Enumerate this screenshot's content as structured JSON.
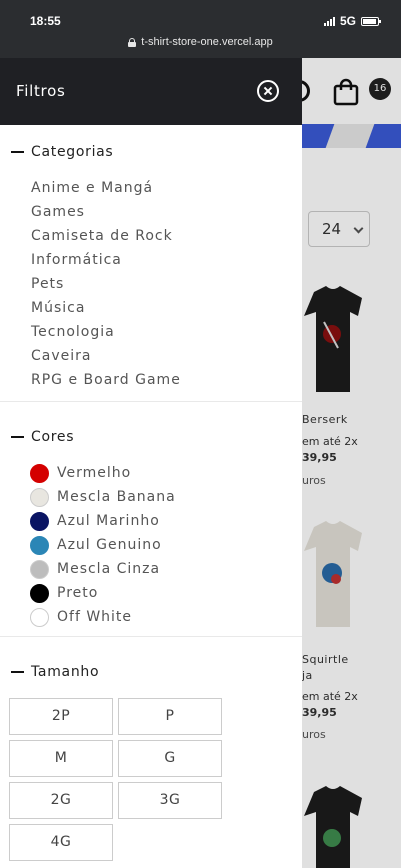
{
  "status_bar": {
    "time": "18:55",
    "network": "5G"
  },
  "browser": {
    "url": "t-shirt-store-one.vercel.app"
  },
  "store": {
    "cart_count": "16",
    "per_page": "24",
    "products": [
      {
        "name": "Berserk",
        "installments": "em até 2x",
        "price": "39,95",
        "extra": "uros"
      },
      {
        "name": "Squirtle",
        "name2": "ja",
        "installments": "em até 2x",
        "price": "39,95",
        "extra": "uros"
      }
    ]
  },
  "drawer": {
    "title": "Filtros",
    "categories": {
      "title": "Categorias",
      "items": [
        "Anime e Mangá",
        "Games",
        "Camiseta de Rock",
        "Informática",
        "Pets",
        "Música",
        "Tecnologia",
        "Caveira",
        "RPG e Board Game"
      ]
    },
    "colors": {
      "title": "Cores",
      "items": [
        {
          "label": "Vermelho",
          "color": "#d40000"
        },
        {
          "label": "Mescla Banana",
          "color": "#e8e6e0"
        },
        {
          "label": "Azul Marinho",
          "color": "#0a1463"
        },
        {
          "label": "Azul Genuino",
          "color": "#2b86b6"
        },
        {
          "label": "Mescla Cinza",
          "color": "#bdbdbd"
        },
        {
          "label": "Preto",
          "color": "#000000"
        },
        {
          "label": "Off White",
          "color": "#ffffff"
        }
      ]
    },
    "sizes": {
      "title": "Tamanho",
      "items": [
        "2P",
        "P",
        "M",
        "G",
        "2G",
        "3G",
        "4G"
      ]
    }
  }
}
